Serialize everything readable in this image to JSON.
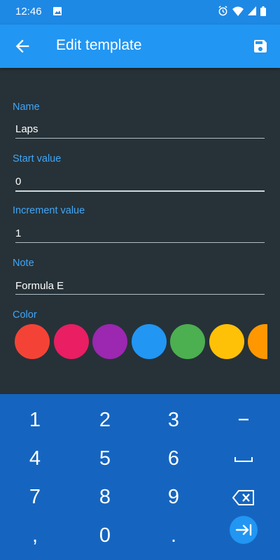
{
  "status_bar": {
    "time": "12:46"
  },
  "app_bar": {
    "title": "Edit template"
  },
  "form": {
    "name_label": "Name",
    "name_value": "Laps",
    "start_label": "Start value",
    "start_value": "0",
    "increment_label": "Increment value",
    "increment_value": "1",
    "note_label": "Note",
    "note_value": "Formula E",
    "color_label": "Color"
  },
  "colors": [
    "#F44336",
    "#E91E63",
    "#9C27B0",
    "#2196F3",
    "#4CAF50",
    "#FFC107",
    "#FF9800"
  ],
  "keyboard": {
    "keys": [
      "1",
      "2",
      "3",
      "−",
      "4",
      "5",
      "6",
      "space",
      "7",
      "8",
      "9",
      "backspace",
      ",",
      "0",
      ".",
      "tab"
    ]
  }
}
